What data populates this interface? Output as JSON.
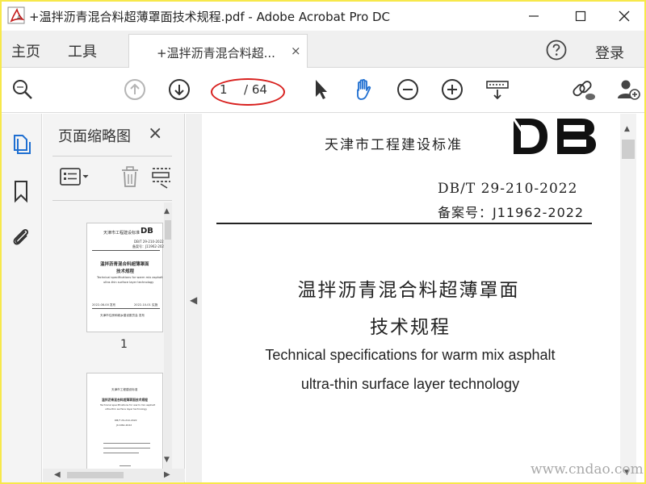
{
  "window": {
    "title": "+温拌沥青混合料超薄罩面技术规程.pdf - Adobe Acrobat Pro DC",
    "logo_icon": "acrobat-logo-icon",
    "controls": [
      "minimize-icon",
      "maximize-icon",
      "close-icon"
    ]
  },
  "tabs": {
    "home": "主页",
    "tools": "工具",
    "document": "+温拌沥青混合料超...",
    "document_close": "×",
    "login": "登录"
  },
  "toolbar": {
    "icons": [
      "search-icon",
      "prev-page-icon",
      "next-page-icon",
      "select-cursor-icon",
      "hand-tool-icon",
      "zoom-out-icon",
      "zoom-in-icon",
      "page-fit-icon",
      "share-link-icon",
      "add-user-icon"
    ],
    "current_page": "1",
    "total_pages": "/ 64"
  },
  "rail": {
    "icons": [
      "page-thumbnails-icon",
      "bookmark-icon",
      "attachment-icon"
    ]
  },
  "thumbnail_panel": {
    "title": "页面缩略图",
    "close": "×",
    "page1_label": "1",
    "thumb1": {
      "org": "天津市工程建设标准",
      "code": "DB/T 29-210-2022",
      "record": "备案号：J11962-2022",
      "title1": "温拌沥青混合料超薄罩面",
      "title2": "技术规程",
      "en1": "Technical specifications for warm mix asphalt",
      "en2": "ultra-thin surface layer technology",
      "date_left": "2022-08-00 发布",
      "date_right": "2022-10-01 实施",
      "issuer": "天津市住房和城乡建设委员会 发布"
    },
    "thumb2": {
      "org": "天津市工程建设标准",
      "title": "温拌沥青混合料超薄罩面技术规程",
      "en1": "Technical specifications for warm mix asphalt",
      "en2": "ultra-thin surface layer technology",
      "code": "DB/T 29-210-2022",
      "record": "J11962-2022"
    }
  },
  "document": {
    "org": "天津市工程建设标准",
    "logo": "DB",
    "code": "DB/T 29-210-2022",
    "record": "备案号：J11962-2022",
    "title_line1": "温拌沥青混合料超薄罩面",
    "title_line2": "技术规程",
    "english_line1": "Technical specifications for warm mix asphalt",
    "english_line2": "ultra-thin surface layer technology"
  },
  "watermark": "www.cndao.com",
  "colors": {
    "accent_blue": "#1f6fd1",
    "disabled_gray": "#b5b5b5",
    "annotation_red": "#d8201e",
    "frame_yellow": "#f7e84a"
  }
}
